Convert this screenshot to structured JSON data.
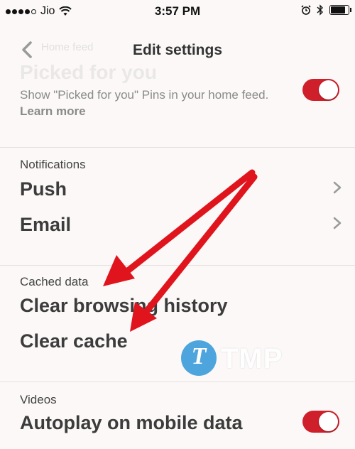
{
  "status_bar": {
    "carrier": "Jio",
    "time": "3:57 PM",
    "alarm_icon": "alarm-clock-icon",
    "bluetooth_icon": "bluetooth-icon"
  },
  "nav": {
    "title": "Edit settings",
    "back_icon": "chevron-left-icon"
  },
  "ghost": {
    "small": "Home feed",
    "big": "Picked for you"
  },
  "picked": {
    "description": "Show \"Picked for you\" Pins in your home feed.",
    "learn_more": "Learn more",
    "toggle_on": true
  },
  "notifications": {
    "header": "Notifications",
    "items": [
      {
        "label": "Push"
      },
      {
        "label": "Email"
      }
    ]
  },
  "cached": {
    "header": "Cached data",
    "items": [
      {
        "label": "Clear browsing history"
      },
      {
        "label": "Clear cache"
      }
    ]
  },
  "videos": {
    "header": "Videos",
    "autoplay_label": "Autoplay on mobile data",
    "toggle_on": true
  },
  "watermark": {
    "letter": "T",
    "text": "TMP"
  },
  "colors": {
    "accent": "#cf1f2b",
    "arrow": "#e0141c",
    "watermark_blue": "#2f96d8"
  }
}
